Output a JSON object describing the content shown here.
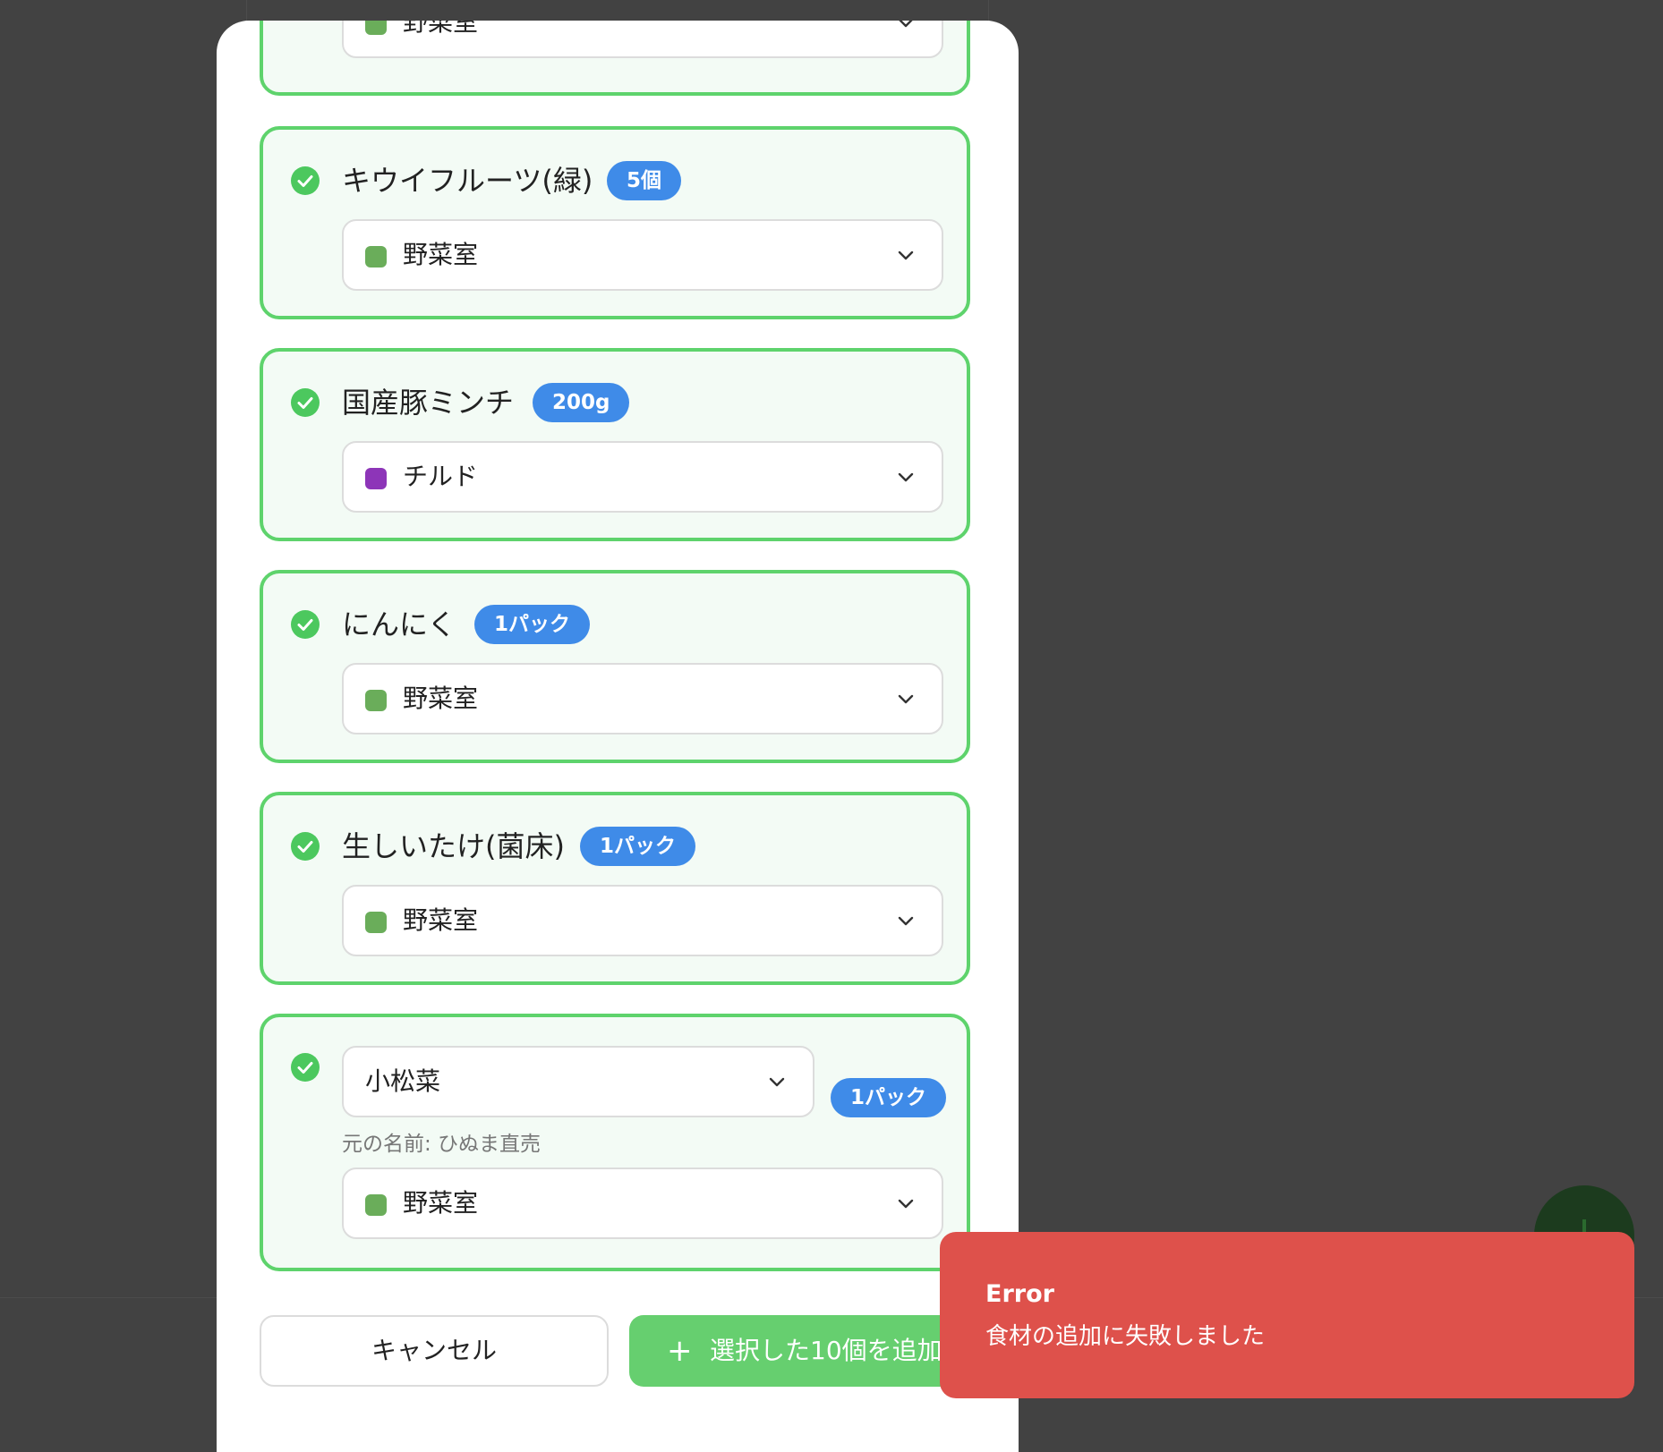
{
  "items": [
    {
      "name": "",
      "badge": "",
      "location": "野菜室",
      "location_color": "#6aad5a"
    },
    {
      "name": "キウイフルーツ(緑)",
      "badge": "5個",
      "location": "野菜室",
      "location_color": "#6aad5a"
    },
    {
      "name": "国産豚ミンチ",
      "badge": "200g",
      "location": "チルド",
      "location_color": "#8d35b8"
    },
    {
      "name": "にんにく",
      "badge": "1パック",
      "location": "野菜室",
      "location_color": "#6aad5a"
    },
    {
      "name": "生しいたけ(菌床)",
      "badge": "1パック",
      "location": "野菜室",
      "location_color": "#6aad5a"
    },
    {
      "name": "小松菜",
      "badge": "1パック",
      "original_name": "元の名前: ひぬま直売",
      "location": "野菜室",
      "location_color": "#6aad5a"
    }
  ],
  "buttons": {
    "cancel": "キャンセル",
    "add_plus": "+",
    "add": "選択した10個を追加"
  },
  "toast": {
    "title": "Error",
    "message": "食材の追加に失敗しました",
    "color": "#de514b"
  },
  "colors": {
    "card_border": "#5ed36c",
    "check": "#4cc85e",
    "badge": "#3f8be8",
    "primary_button": "#66cf6f"
  }
}
